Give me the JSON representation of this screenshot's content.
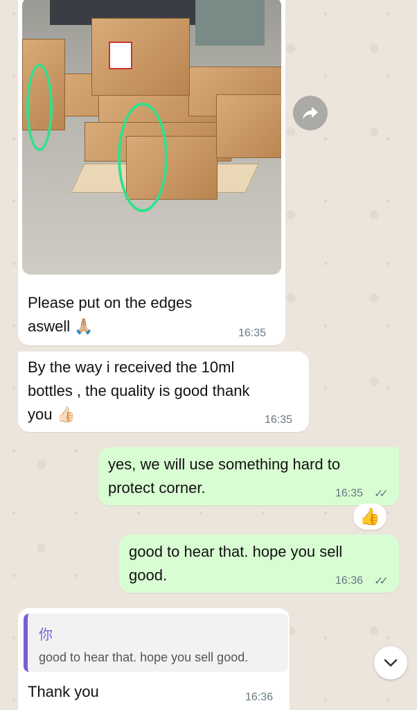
{
  "messages": [
    {
      "id": "m1",
      "direction": "incoming",
      "text": "Please put on the edges\naswell 🙏🏼",
      "time": "16:35"
    },
    {
      "id": "m2",
      "direction": "incoming",
      "text": "By the way i received the 10ml\nbottles , the quality is good thank\nyou 👍🏻",
      "time": "16:35"
    },
    {
      "id": "m3",
      "direction": "outgoing",
      "text": "yes, we will use something hard to\nprotect corner.",
      "time": "16:35",
      "read_ticks": "✓✓",
      "reaction": "👍"
    },
    {
      "id": "m4",
      "direction": "outgoing",
      "text": "good to hear that. hope you sell\ngood.",
      "time": "16:36",
      "read_ticks": "✓✓"
    },
    {
      "id": "m5",
      "direction": "incoming",
      "quote": {
        "author": "你",
        "text": "good to hear that. hope you sell good."
      },
      "text": "Thank you",
      "time": "16:36"
    }
  ],
  "icons": {
    "forward": "forward-arrow-icon",
    "scroll": "chevron-down-icon"
  },
  "colors": {
    "outgoing_bubble": "#d9fdd3",
    "incoming_bubble": "#ffffff",
    "quote_accent": "#7b5cd6",
    "highlight_stroke": "#30e08e"
  }
}
